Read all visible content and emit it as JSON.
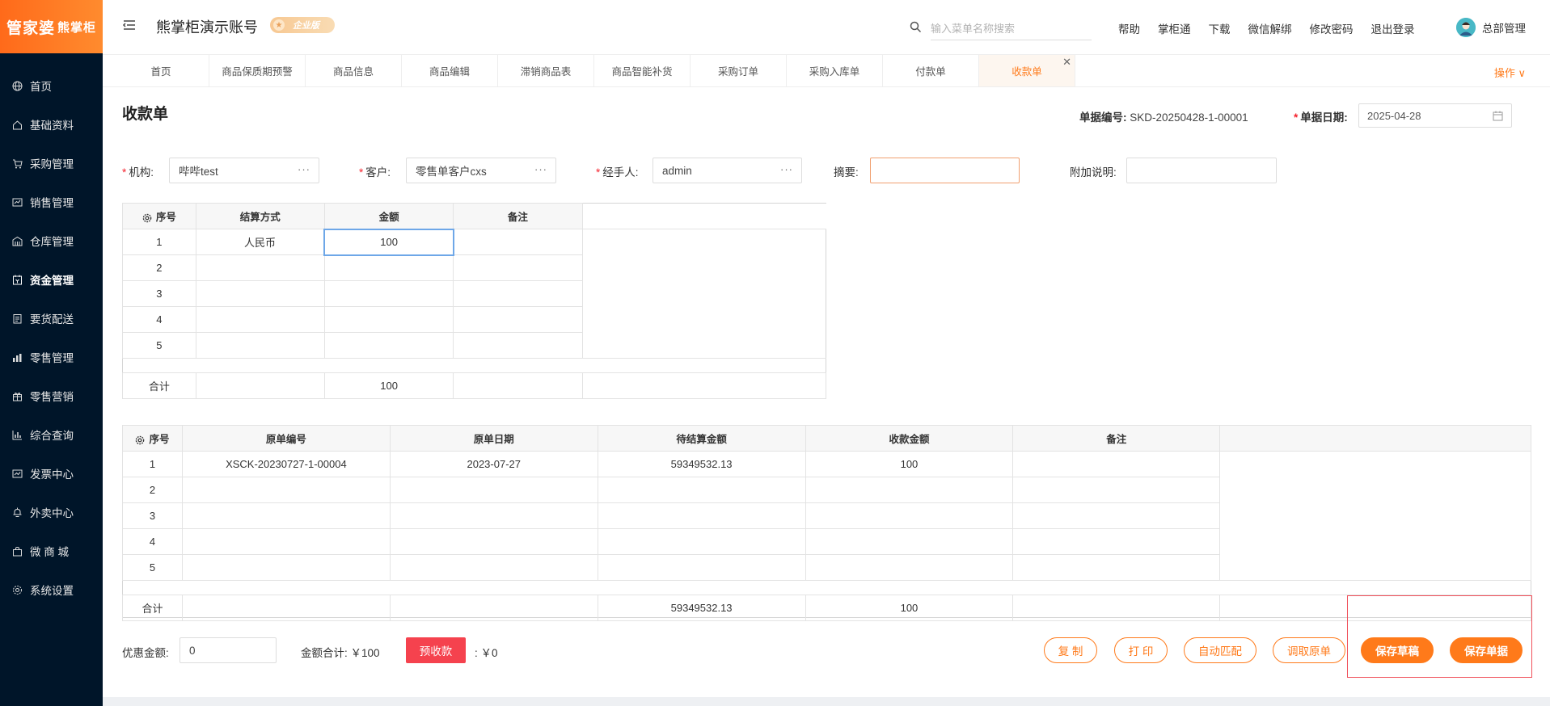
{
  "app": {
    "logo_main": "管家婆",
    "logo_sub": "熊掌柜",
    "account_title": "熊掌柜演示账号",
    "edition_badge": "企业版"
  },
  "sidebar": {
    "items": [
      {
        "label": "首页",
        "icon": "globe-icon"
      },
      {
        "label": "基础资料",
        "icon": "home-icon"
      },
      {
        "label": "采购管理",
        "icon": "cart-icon"
      },
      {
        "label": "销售管理",
        "icon": "sales-icon"
      },
      {
        "label": "仓库管理",
        "icon": "warehouse-icon"
      },
      {
        "label": "资金管理",
        "icon": "finance-icon"
      },
      {
        "label": "要货配送",
        "icon": "delivery-icon"
      },
      {
        "label": "零售管理",
        "icon": "retail-icon"
      },
      {
        "label": "零售营销",
        "icon": "gift-icon"
      },
      {
        "label": "综合查询",
        "icon": "chart-icon"
      },
      {
        "label": "发票中心",
        "icon": "invoice-icon"
      },
      {
        "label": "外卖中心",
        "icon": "bell-icon"
      },
      {
        "label": "微 商 城",
        "icon": "bag-icon"
      },
      {
        "label": "系统设置",
        "icon": "gear-icon"
      }
    ]
  },
  "header": {
    "search_placeholder": "输入菜单名称搜索",
    "links": [
      "帮助",
      "掌柜通",
      "下载",
      "微信解绑",
      "修改密码",
      "退出登录"
    ],
    "user_name": "总部管理"
  },
  "tabs": {
    "items": [
      "首页",
      "商品保质期预警",
      "商品信息",
      "商品编辑",
      "滞销商品表",
      "商品智能补货",
      "采购订单",
      "采购入库单",
      "付款单",
      "收款单"
    ],
    "active_index": 9,
    "ops_label": "操作 ∨"
  },
  "form": {
    "page_title": "收款单",
    "doc_no_label": "单据编号:",
    "doc_no": "SKD-20250428-1-00001",
    "doc_date_label": "单据日期:",
    "doc_date": "2025-04-28",
    "org_label": "机构:",
    "org_value": "哔哔test",
    "customer_label": "客户:",
    "customer_value": "零售单客户cxs",
    "handler_label": "经手人:",
    "handler_value": "admin",
    "summary_label": "摘要:",
    "summary_value": "",
    "note_label": "附加说明:",
    "note_value": "",
    "dots": "···"
  },
  "settle_table": {
    "headers": [
      "序号",
      "结算方式",
      "金额",
      "备注"
    ],
    "rows": [
      {
        "no": "1",
        "method": "人民币",
        "amount": "100",
        "note": ""
      },
      {
        "no": "2",
        "method": "",
        "amount": "",
        "note": ""
      },
      {
        "no": "3",
        "method": "",
        "amount": "",
        "note": ""
      },
      {
        "no": "4",
        "method": "",
        "amount": "",
        "note": ""
      },
      {
        "no": "5",
        "method": "",
        "amount": "",
        "note": ""
      }
    ],
    "total_label": "合计",
    "total_amount": "100"
  },
  "source_table": {
    "headers": [
      "序号",
      "原单编号",
      "原单日期",
      "待结算金额",
      "收款金额",
      "备注"
    ],
    "rows": [
      {
        "no": "1",
        "source_no": "XSCK-20230727-1-00004",
        "date": "2023-07-27",
        "pending": "59349532.13",
        "received": "100",
        "note": ""
      },
      {
        "no": "2",
        "source_no": "",
        "date": "",
        "pending": "",
        "received": "",
        "note": ""
      },
      {
        "no": "3",
        "source_no": "",
        "date": "",
        "pending": "",
        "received": "",
        "note": ""
      },
      {
        "no": "4",
        "source_no": "",
        "date": "",
        "pending": "",
        "received": "",
        "note": ""
      },
      {
        "no": "5",
        "source_no": "",
        "date": "",
        "pending": "",
        "received": "",
        "note": ""
      }
    ],
    "total_label": "合计",
    "total_pending": "59349532.13",
    "total_received": "100"
  },
  "footer": {
    "discount_label": "优惠金额:",
    "discount_value": "0",
    "total_text": "金额合计: ￥100",
    "prepay_label": "预收款",
    "prepay_value": ": ￥0",
    "buttons": {
      "copy": "复 制",
      "print": "打 印",
      "auto_match": "自动匹配",
      "fetch_source": "调取原单",
      "save_draft": "保存草稿",
      "save_doc": "保存单据"
    }
  },
  "colors": {
    "accent": "#ff7a1a",
    "sidebar_bg": "#001529",
    "prepay": "#f5424e"
  }
}
